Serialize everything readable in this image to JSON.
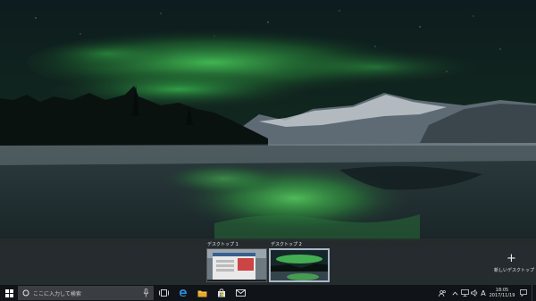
{
  "task_view": {
    "desktops": [
      {
        "label": "デスクトップ 1",
        "active": false
      },
      {
        "label": "デスクトップ 2",
        "active": true
      }
    ],
    "new_desktop_label": "新しいデスクトップ",
    "new_desktop_icon": "plus-icon"
  },
  "taskbar": {
    "search_placeholder": "ここに入力して検索",
    "pinned_apps": [
      "task-view-icon",
      "edge-icon",
      "file-explorer-icon",
      "store-icon",
      "mail-icon"
    ],
    "tray": {
      "ime_indicator": "A",
      "time": "18:05",
      "date": "2017/11/19"
    }
  },
  "colors": {
    "taskbar_bg": "#101418",
    "search_bg": "#3a3d42",
    "accent_edge": "#2f8fdc",
    "aurora": "#3fcf4f"
  }
}
